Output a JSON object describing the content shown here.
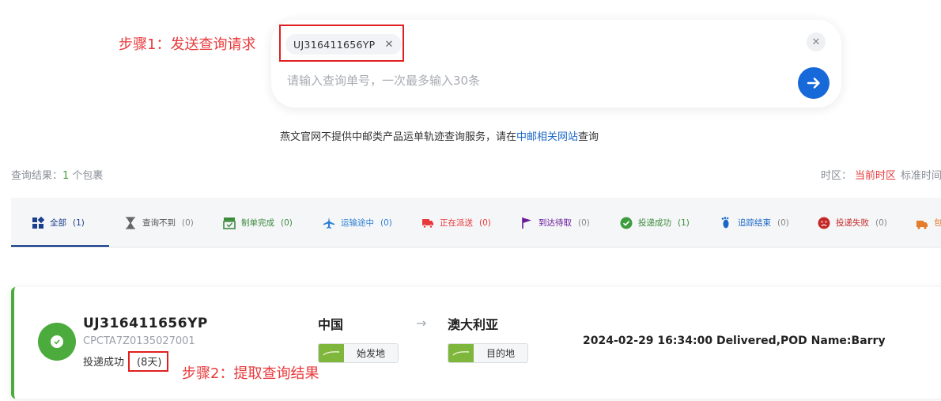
{
  "annotations": {
    "step1": "步骤1：发送查询请求",
    "step2": "步骤2：提取查询结果"
  },
  "search": {
    "tag_value": "UJ316411656YP",
    "placeholder": "请输入查询单号，一次最多输入30条"
  },
  "notice": {
    "prefix": "燕文官网不提供中邮类产品运单轨迹查询服务，请在",
    "link": "中邮相关网站",
    "suffix": "查询"
  },
  "summary": {
    "label": "查询结果：",
    "count": "1",
    "unit": " 个包裹"
  },
  "timezone": {
    "label": "时区：",
    "current": "当前时区",
    "standard": "标准时间"
  },
  "tabs": [
    {
      "label": "全部",
      "count": "(1)",
      "icon": "grid-icon",
      "color": "#1a3f8c"
    },
    {
      "label": "查询不到",
      "count": "(0)",
      "icon": "hourglass-icon",
      "color": "#666666"
    },
    {
      "label": "制单完成",
      "count": "(0)",
      "icon": "tray-icon",
      "color": "#3d8b3d"
    },
    {
      "label": "运输途中",
      "count": "(0)",
      "icon": "plane-icon",
      "color": "#2b7fd4"
    },
    {
      "label": "正在派送",
      "count": "(0)",
      "icon": "truck-icon",
      "color": "#e8393b"
    },
    {
      "label": "到达待取",
      "count": "(0)",
      "icon": "flag-icon",
      "color": "#6a1b9a"
    },
    {
      "label": "投递成功",
      "count": "(1)",
      "icon": "check-circle-icon",
      "color": "#3d8b3d"
    },
    {
      "label": "追踪结束",
      "count": "(0)",
      "icon": "footprint-icon",
      "color": "#1a67c7"
    },
    {
      "label": "投递失败",
      "count": "(0)",
      "icon": "sad-face-icon",
      "color": "#c62828"
    },
    {
      "label": "包",
      "count": "",
      "icon": "package-icon",
      "color": "#e57c2b"
    }
  ],
  "result": {
    "tracking_no": "UJ316411656YP",
    "ref_no": "CPCTA7Z0135027001",
    "status": "投递成功",
    "days": "(8天)",
    "origin": "中国",
    "origin_label": "始发地",
    "destination": "澳大利亚",
    "destination_label": "目的地",
    "latest_event": "2024-02-29 16:34:00 Delivered,POD Name:Barry",
    "status_color": "#4bab3c"
  }
}
